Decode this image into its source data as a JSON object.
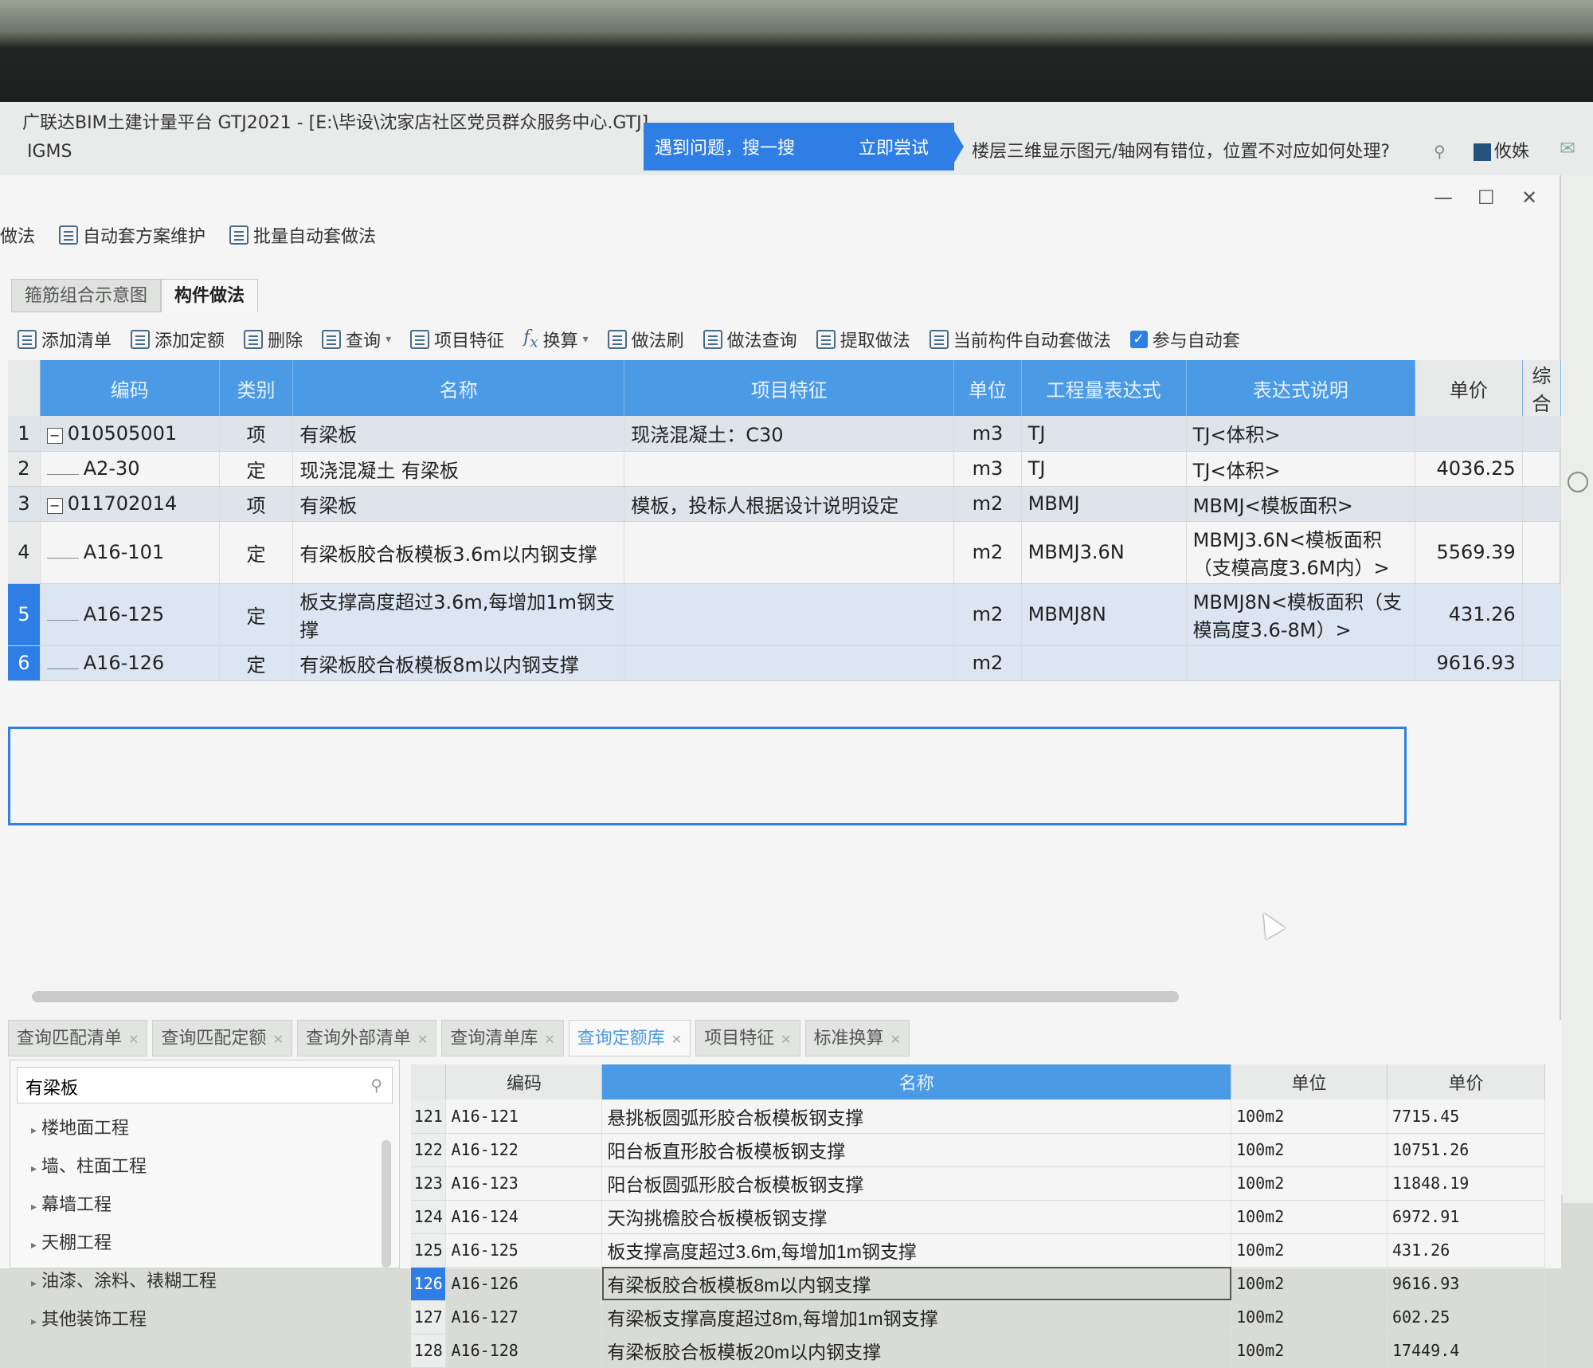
{
  "app": {
    "title": "广联达BIM土建计量平台 GTJ2021 - [E:\\毕设\\沈家店社区党员群众服务中心.GTJ]",
    "subtitle": "IGMS",
    "search_label": "遇到问题，搜一搜",
    "search_try": "立即尝试",
    "hint": "楼层三维显示图元/轴网有错位，位置不对应如何处理?",
    "user": "攸姝"
  },
  "toolbar1": [
    {
      "label": "做法",
      "icon": "doc-icon"
    },
    {
      "label": "自动套方案维护",
      "icon": "doc-icon"
    },
    {
      "label": "批量自动套做法",
      "icon": "batch-icon"
    }
  ],
  "tabs": [
    {
      "label": "箍筋组合示意图",
      "active": false
    },
    {
      "label": "构件做法",
      "active": true
    }
  ],
  "toolbar2": [
    {
      "label": "添加清单"
    },
    {
      "label": "添加定额"
    },
    {
      "label": "删除"
    },
    {
      "label": "查询"
    },
    {
      "label": "项目特征"
    },
    {
      "label": "换算"
    },
    {
      "label": "做法刷"
    },
    {
      "label": "做法查询"
    },
    {
      "label": "提取做法"
    },
    {
      "label": "当前构件自动套做法"
    }
  ],
  "auto_checkbox": {
    "label": "参与自动套",
    "checked": true
  },
  "grid": {
    "columns": [
      "编码",
      "类别",
      "名称",
      "项目特征",
      "单位",
      "工程量表达式",
      "表达式说明",
      "单价",
      "综合"
    ],
    "rows": [
      {
        "num": "1",
        "code": "010505001",
        "type": "项",
        "name": "有梁板",
        "feature": "现浇混凝土：C30",
        "unit": "m3",
        "expr": "TJ",
        "desc": "TJ<体积>",
        "price": "",
        "kind": "item"
      },
      {
        "num": "2",
        "code": "A2-30",
        "type": "定",
        "name": "现浇混凝土 有梁板",
        "feature": "",
        "unit": "m3",
        "expr": "TJ",
        "desc": "TJ<体积>",
        "price": "4036.25",
        "kind": "sub"
      },
      {
        "num": "3",
        "code": "011702014",
        "type": "项",
        "name": "有梁板",
        "feature": "模板，投标人根据设计说明设定",
        "unit": "m2",
        "expr": "MBMJ",
        "desc": "MBMJ<模板面积>",
        "price": "",
        "kind": "item"
      },
      {
        "num": "4",
        "code": "A16-101",
        "type": "定",
        "name": "有梁板胶合板模板3.6m以内钢支撑",
        "feature": "",
        "unit": "m2",
        "expr": "MBMJ3.6N",
        "desc": "MBMJ3.6N<模板面积（支模高度3.6M内）>",
        "price": "5569.39",
        "kind": "sub"
      },
      {
        "num": "5",
        "code": "A16-125",
        "type": "定",
        "name": "板支撑高度超过3.6m,每增加1m钢支撑",
        "feature": "",
        "unit": "m2",
        "expr": "MBMJ8N",
        "desc": "MBMJ8N<模板面积（支模高度3.6-8M）>",
        "price": "431.26",
        "kind": "sel"
      },
      {
        "num": "6",
        "code": "A16-126",
        "type": "定",
        "name": "有梁板胶合板模板8m以内钢支撑",
        "feature": "",
        "unit": "m2",
        "expr": "",
        "desc": "",
        "price": "9616.93",
        "kind": "sel"
      }
    ]
  },
  "bottom_tabs": [
    {
      "label": "查询匹配清单",
      "active": false
    },
    {
      "label": "查询匹配定额",
      "active": false
    },
    {
      "label": "查询外部清单",
      "active": false
    },
    {
      "label": "查询清单库",
      "active": false
    },
    {
      "label": "查询定额库",
      "active": true
    },
    {
      "label": "项目特征",
      "active": false
    },
    {
      "label": "标准换算",
      "active": false
    }
  ],
  "left_panel": {
    "search_value": "有梁板",
    "tree": [
      "楼地面工程",
      "墙、柱面工程",
      "幕墙工程",
      "天棚工程",
      "油漆、涂料、裱糊工程",
      "其他装饰工程"
    ]
  },
  "quota_grid": {
    "columns": [
      "编码",
      "名称",
      "单位",
      "单价"
    ],
    "rows": [
      {
        "num": "121",
        "code": "A16-121",
        "name": "悬挑板圆弧形胶合板模板钢支撑",
        "unit": "100m2",
        "price": "7715.45"
      },
      {
        "num": "122",
        "code": "A16-122",
        "name": "阳台板直形胶合板模板钢支撑",
        "unit": "100m2",
        "price": "10751.26"
      },
      {
        "num": "123",
        "code": "A16-123",
        "name": "阳台板圆弧形胶合板模板钢支撑",
        "unit": "100m2",
        "price": "11848.19"
      },
      {
        "num": "124",
        "code": "A16-124",
        "name": "天沟挑檐胶合板模板钢支撑",
        "unit": "100m2",
        "price": "6972.91"
      },
      {
        "num": "125",
        "code": "A16-125",
        "name": "板支撑高度超过3.6m,每增加1m钢支撑",
        "unit": "100m2",
        "price": "431.26"
      },
      {
        "num": "126",
        "code": "A16-126",
        "name": "有梁板胶合板模板8m以内钢支撑",
        "unit": "100m2",
        "price": "9616.93"
      },
      {
        "num": "127",
        "code": "A16-127",
        "name": "有梁板支撑高度超过8m,每增加1m钢支撑",
        "unit": "100m2",
        "price": "602.25"
      },
      {
        "num": "128",
        "code": "A16-128",
        "name": "有梁板胶合板模板20m以内钢支撑",
        "unit": "100m2",
        "price": "17449.4"
      }
    ],
    "highlight_num": "126"
  }
}
